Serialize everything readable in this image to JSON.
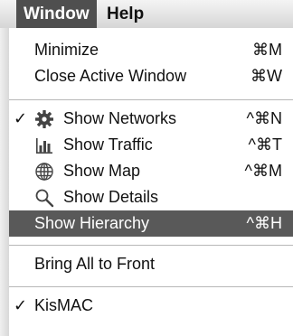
{
  "menubar": {
    "window_label": "Window",
    "help_label": "Help"
  },
  "menu": {
    "items": [
      {
        "label": "Minimize",
        "shortcut": "⌘M"
      },
      {
        "label": "Close Active Window",
        "shortcut": "⌘W"
      },
      {
        "label": "Show Networks",
        "shortcut": "^⌘N",
        "checked": true,
        "icon": "gear-icon"
      },
      {
        "label": "Show Traffic",
        "shortcut": "^⌘T",
        "icon": "bar-chart-icon"
      },
      {
        "label": "Show Map",
        "shortcut": "^⌘M",
        "icon": "globe-icon"
      },
      {
        "label": "Show Details",
        "shortcut": "",
        "icon": "magnifier-icon"
      },
      {
        "label": "Show Hierarchy",
        "shortcut": "^⌘H",
        "highlighted": true
      },
      {
        "label": "Bring All to Front",
        "shortcut": ""
      },
      {
        "label": "KisMAC",
        "shortcut": "",
        "checked": true
      }
    ],
    "check_glyph": "✓",
    "highlight_color": "#595959"
  }
}
